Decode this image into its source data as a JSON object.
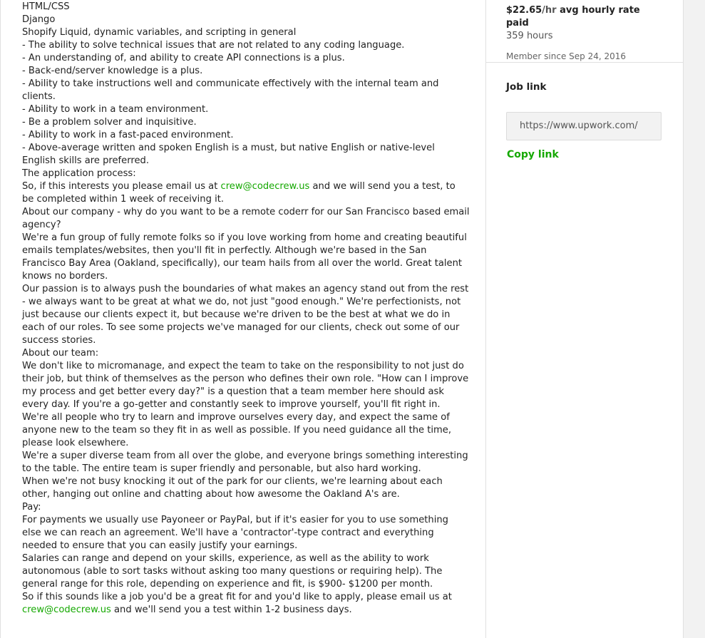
{
  "description": {
    "lines": [
      "HTML/CSS",
      "Django",
      "Shopify Liquid, dynamic variables, and scripting in general",
      "- The ability to solve technical issues that are not related to any coding language.",
      "- An understanding of, and ability to create API connections is a plus.",
      "- Back-end/server knowledge is a plus.",
      "- Ability to take instructions well and communicate effectively with the internal team and clients.",
      "- Ability to work in a team environment.",
      "- Be a problem solver and inquisitive.",
      "- Ability to work in a fast-paced environment.",
      "- Above-average written and spoken English is a must, but native English or native-level English skills are preferred.",
      "The application process:"
    ],
    "apply_before": "So, if this interests you please email us at ",
    "email": "crew@codecrew.us",
    "apply_after": " and we will send you a test, to be completed within 1 week of receiving it.",
    "lines2": [
      "About our company - why do you want to be a remote coderr for our San Francisco based email agency?",
      "We're a fun group of fully remote folks so if you love working from home and creating beautiful emails templates/websites, then you'll fit in perfectly. Although we're based in the San Francisco Bay Area (Oakland, specifically), our team hails from all over the world. Great talent knows no borders.",
      "Our passion is to always push the boundaries of what makes an agency stand out from the rest - we always want to be great at what we do, not just \"good enough.\" We're perfectionists, not just because our clients expect it, but because we're driven to be the best at what we do in each of our roles. To see some projects we've managed for our clients, check out some of our success stories.",
      "About our team:",
      "We don't like to micromanage, and expect the team to take on the responsibility to not just do their job, but think of themselves as the person who defines their own role. \"How can I improve my process and get better every day?\" is a question that a team member here should ask every day. If you're a go-getter and constantly seek to improve yourself, you'll fit right in.",
      "We're all people who try to learn and improve ourselves every day, and expect the same of anyone new to the team so they fit in as well as possible. If you need guidance all the time, please look elsewhere.",
      "We're a super diverse team from all over the globe, and everyone brings something interesting to the table. The entire team is super friendly and personable, but also hard working.",
      "When we're not busy knocking it out of the park for our clients, we're learning about each other, hanging out online and chatting about how awesome the Oakland A's are.",
      "Pay:",
      "For payments we usually use Payoneer or PayPal, but if it's easier for you to use something else we can reach an agreement. We'll have a 'contractor'-type contract and everything needed to ensure that you can easily justify your earnings.",
      "Salaries can range and depend on your skills, experience, as well as the ability to work autonomous (able to sort tasks without asking too many questions or requiring help). The general range for this role, depending on experience and fit, is $900- $1200 per month."
    ],
    "final_before": "So if this sounds like a job you'd be a great fit for and you'd like to apply, please email us at ",
    "final_email": "crew@codecrew.us",
    "final_after": " and we'll send you a test within 1-2 business days."
  },
  "client": {
    "rate_value": "$22.65",
    "rate_unit": "/hr",
    "rate_label": " avg hourly rate paid",
    "hours": "359 hours",
    "member_since": "Member since Sep 24, 2016"
  },
  "job_link": {
    "title": "Job link",
    "url": "https://www.upwork.com/",
    "copy_label": "Copy link"
  },
  "colors": {
    "accent": "#14a800",
    "background": "#f2f2f2"
  }
}
